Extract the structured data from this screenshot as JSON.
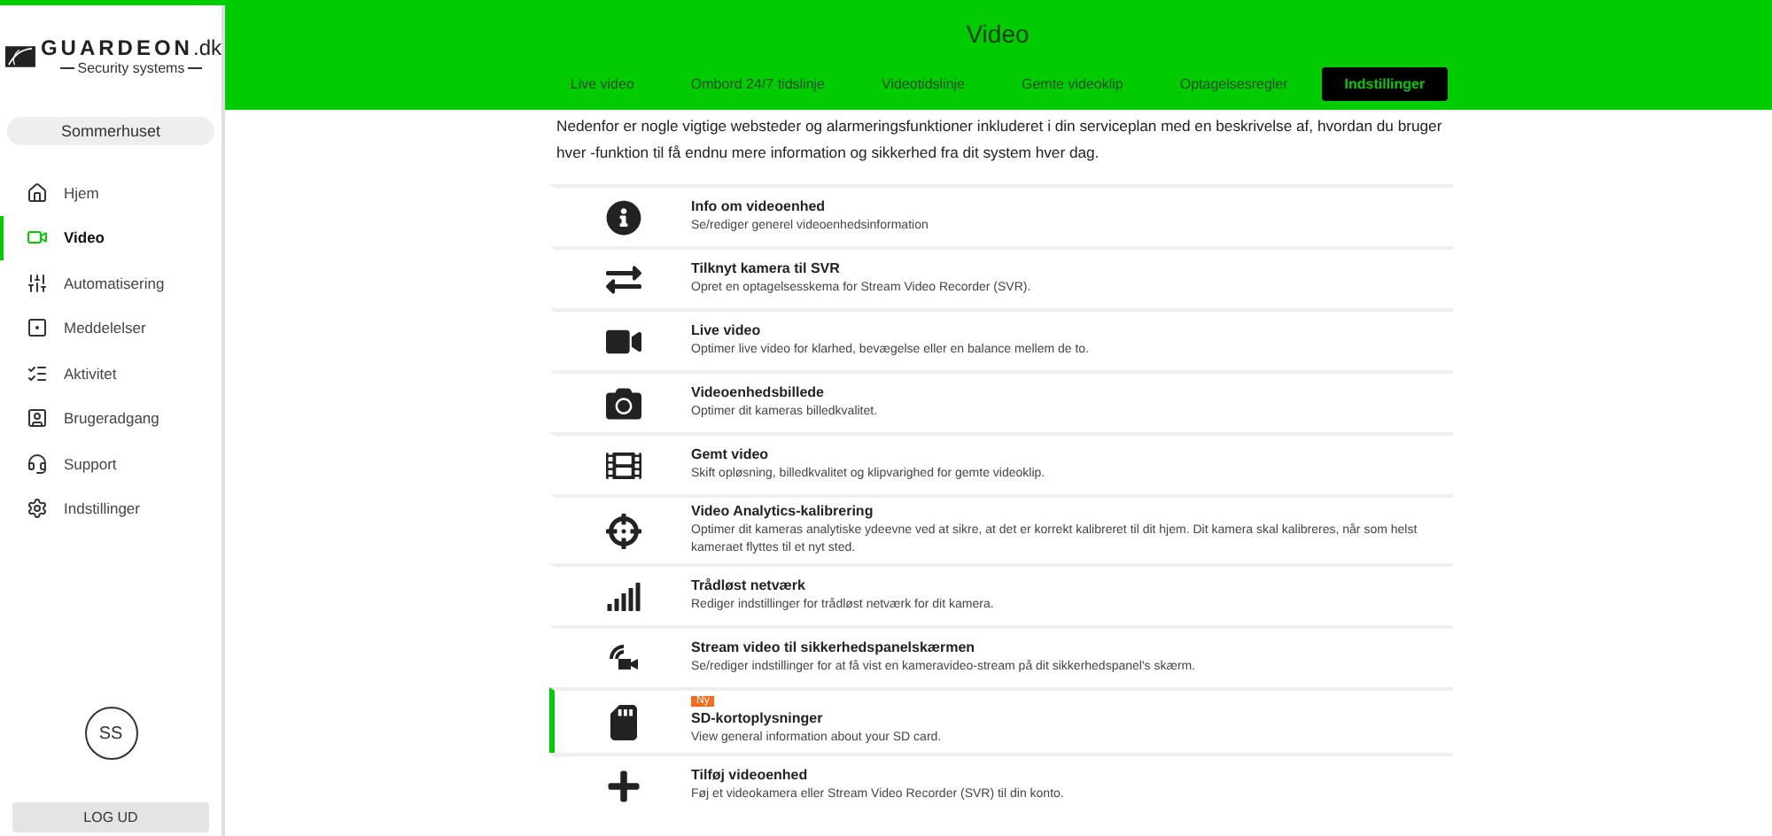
{
  "logo": {
    "name": "GUARDEON",
    "suffix": ".dk",
    "tagline": "Security systems"
  },
  "header": {
    "title": "Video"
  },
  "tabs": [
    {
      "label": "Live video",
      "selected": false
    },
    {
      "label": "Ombord 24/7 tidslinje",
      "selected": false
    },
    {
      "label": "Videotidslinje",
      "selected": false
    },
    {
      "label": "Gemte videoklip",
      "selected": false
    },
    {
      "label": "Optagelsesregler",
      "selected": false
    },
    {
      "label": "Indstillinger",
      "selected": true
    }
  ],
  "sidebar": {
    "location": "Sommerhuset",
    "items": [
      {
        "label": "Hjem",
        "selected": false
      },
      {
        "label": "Video",
        "selected": true
      },
      {
        "label": "Automatisering",
        "selected": false
      },
      {
        "label": "Meddelelser",
        "selected": false
      },
      {
        "label": "Aktivitet",
        "selected": false
      },
      {
        "label": "Brugeradgang",
        "selected": false
      },
      {
        "label": "Support",
        "selected": false
      },
      {
        "label": "Indstillinger",
        "selected": false
      }
    ],
    "avatar": "SS",
    "logout": "LOG UD"
  },
  "intro": "Nedenfor er nogle vigtige websteder og alarmeringsfunktioner inkluderet i din serviceplan med en beskrivelse af, hvordan du bruger hver -funktion til få endnu mere information og sikkerhed fra dit system hver dag.",
  "settings": [
    {
      "title": "Info om videoenhed",
      "description": "Se/rediger generel videoenhedsinformation",
      "selected": false
    },
    {
      "title": "Tilknyt kamera til SVR",
      "description": "Opret en optagelsesskema for Stream Video Recorder (SVR).",
      "selected": false
    },
    {
      "title": "Live video",
      "description": "Optimer live video for klarhed, bevægelse eller en balance mellem de to.",
      "selected": false
    },
    {
      "title": "Videoenhedsbillede",
      "description": "Optimer dit kameras billedkvalitet.",
      "selected": false
    },
    {
      "title": "Gemt video",
      "description": "Skift opløsning, billedkvalitet og klipvarighed for gemte videoklip.",
      "selected": false
    },
    {
      "title": "Video Analytics-kalibrering",
      "description": "Optimer dit kameras analytiske ydeevne ved at sikre, at det er korrekt kalibreret til dit hjem. Dit kamera skal kalibreres, når som helst kameraet flyttes til et nyt sted.",
      "selected": false
    },
    {
      "title": "Trådløst netværk",
      "description": "Rediger indstillinger for trådløst netværk for dit kamera.",
      "selected": false
    },
    {
      "title": "Stream video til sikkerhedspanelskærmen",
      "description": "Se/rediger indstillinger for at få vist en kameravideo-stream på dit sikkerhedspanel's skærm.",
      "selected": false
    },
    {
      "title": "SD-kortoplysninger",
      "description": "View general information about your SD card.",
      "badge": "Ny",
      "selected": true
    },
    {
      "title": "Tilføj videoenhed",
      "description": "Føj et videokamera eller Stream Video Recorder (SVR) til din konto.",
      "selected": false
    }
  ]
}
